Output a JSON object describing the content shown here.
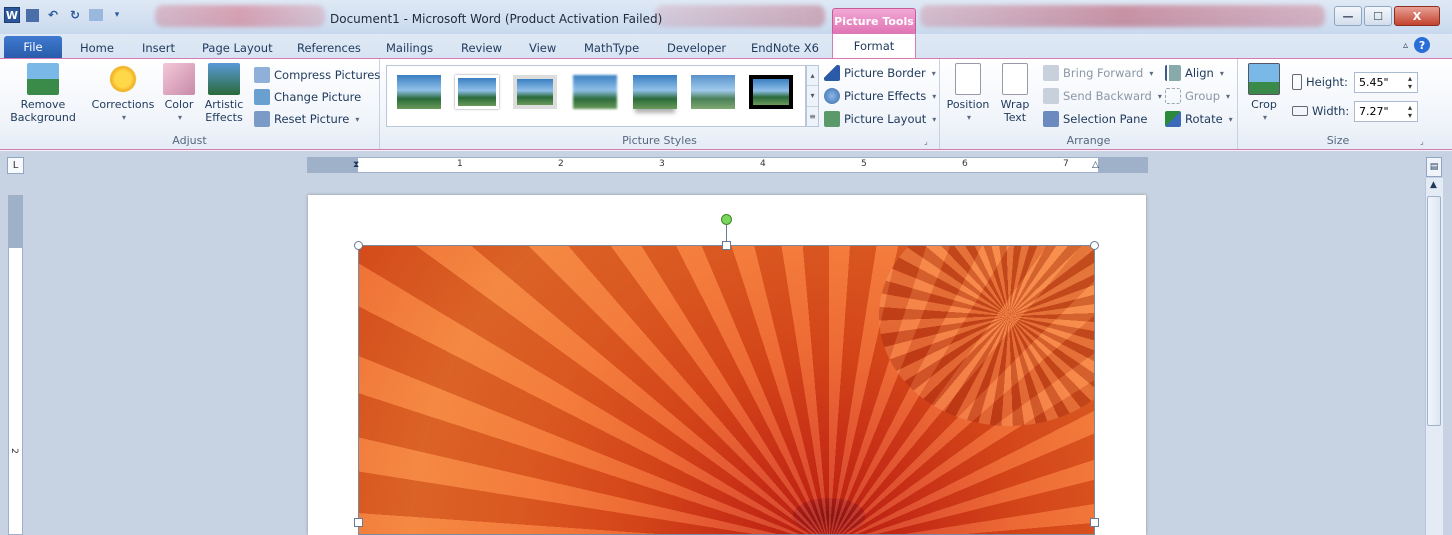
{
  "window": {
    "title": "Document1 - Microsoft Word (Product Activation Failed)",
    "context_tab_group": "Picture Tools",
    "controls": {
      "minimize": "—",
      "maximize": "☐",
      "close": "X"
    }
  },
  "quick_access": {
    "app_icon": "W",
    "save": "▪",
    "undo": "↶",
    "redo": "↻"
  },
  "tabs": [
    "File",
    "Home",
    "Insert",
    "Page Layout",
    "References",
    "Mailings",
    "Review",
    "View",
    "MathType",
    "Developer",
    "EndNote X6",
    "Format"
  ],
  "ribbon": {
    "adjust": {
      "label": "Adjust",
      "remove_background": [
        "Remove",
        "Background"
      ],
      "corrections": "Corrections",
      "color": "Color",
      "artistic_effects": [
        "Artistic",
        "Effects"
      ],
      "compress": "Compress Pictures",
      "change": "Change Picture",
      "reset": "Reset Picture"
    },
    "styles": {
      "label": "Picture Styles",
      "border": "Picture Border",
      "effects": "Picture Effects",
      "layout": "Picture Layout",
      "thumbnail_count": 7
    },
    "arrange": {
      "label": "Arrange",
      "position": "Position",
      "wrap_text": [
        "Wrap",
        "Text"
      ],
      "bring_forward": "Bring Forward",
      "send_backward": "Send Backward",
      "selection_pane": "Selection Pane",
      "align": "Align",
      "group": "Group",
      "rotate": "Rotate"
    },
    "size": {
      "label": "Size",
      "crop": "Crop",
      "height_label": "Height:",
      "height_value": "5.45\"",
      "width_label": "Width:",
      "width_value": "7.27\""
    }
  },
  "ruler": {
    "tab_selector": "L",
    "numbers": [
      "1",
      "2",
      "3",
      "4",
      "5",
      "6",
      "7"
    ],
    "vertical_number": "2"
  },
  "colors": {
    "format_accent": "#d67ab5",
    "file_tab": "#2a5caa",
    "workspace": "#c7d3e2"
  }
}
